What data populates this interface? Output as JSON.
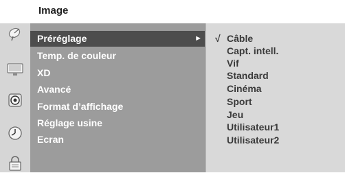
{
  "header": {
    "title": "Image"
  },
  "menu": {
    "items": [
      {
        "label": "Préréglage"
      },
      {
        "label": "Temp. de couleur"
      },
      {
        "label": "XD"
      },
      {
        "label": "Avancé"
      },
      {
        "label": "Format d’affichage"
      },
      {
        "label": "Réglage usine"
      },
      {
        "label": "Ecran"
      }
    ],
    "selected_arrow": "►"
  },
  "submenu": {
    "check": "√",
    "options": [
      {
        "label": "Câble"
      },
      {
        "label": "Capt. intell."
      },
      {
        "label": "Vif"
      },
      {
        "label": "Standard"
      },
      {
        "label": "Cinéma"
      },
      {
        "label": "Sport"
      },
      {
        "label": "Jeu"
      },
      {
        "label": "Utilisateur1"
      },
      {
        "label": "Utilisateur2"
      }
    ]
  }
}
